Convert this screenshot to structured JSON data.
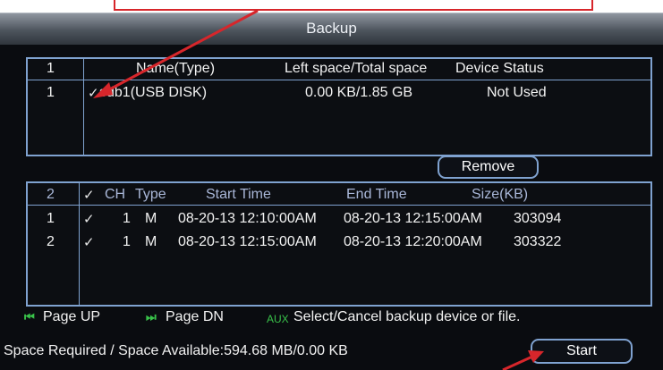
{
  "window": {
    "title": "Backup"
  },
  "device_table": {
    "header": {
      "index": "1",
      "name_type": "Name(Type)",
      "space": "Left space/Total space",
      "status": "Device Status"
    },
    "rows": [
      {
        "index": "1",
        "checked": "✓",
        "name": "sdb1(USB DISK)",
        "space": "0.00 KB/1.85 GB",
        "status": "Not Used"
      }
    ],
    "remove_label": "Remove"
  },
  "file_table": {
    "header": {
      "index": "2",
      "check": "✓",
      "ch": "CH",
      "type": "Type",
      "start": "Start Time",
      "end": "End Time",
      "size": "Size(KB)"
    },
    "rows": [
      {
        "index": "1",
        "check": "✓",
        "ch": "1",
        "type": "M",
        "start": "08-20-13 12:10:00AM",
        "end": "08-20-13 12:15:00AM",
        "size": "303094"
      },
      {
        "index": "2",
        "check": "✓",
        "ch": "1",
        "type": "M",
        "start": "08-20-13 12:15:00AM",
        "end": "08-20-13 12:20:00AM",
        "size": "303322"
      }
    ]
  },
  "footer": {
    "page_up_icon": "⏮",
    "page_up": "Page UP",
    "page_dn_icon": "⏭",
    "page_dn": "Page DN",
    "aux_tag": "AUX",
    "hint": "Select/Cancel backup device or file.",
    "space_label": "Space Required / Space Available:594.68 MB/0.00 KB",
    "start_label": "Start"
  },
  "colors": {
    "callout": "#d7262b",
    "border": "#7fa2d0",
    "green": "#39c24a"
  }
}
